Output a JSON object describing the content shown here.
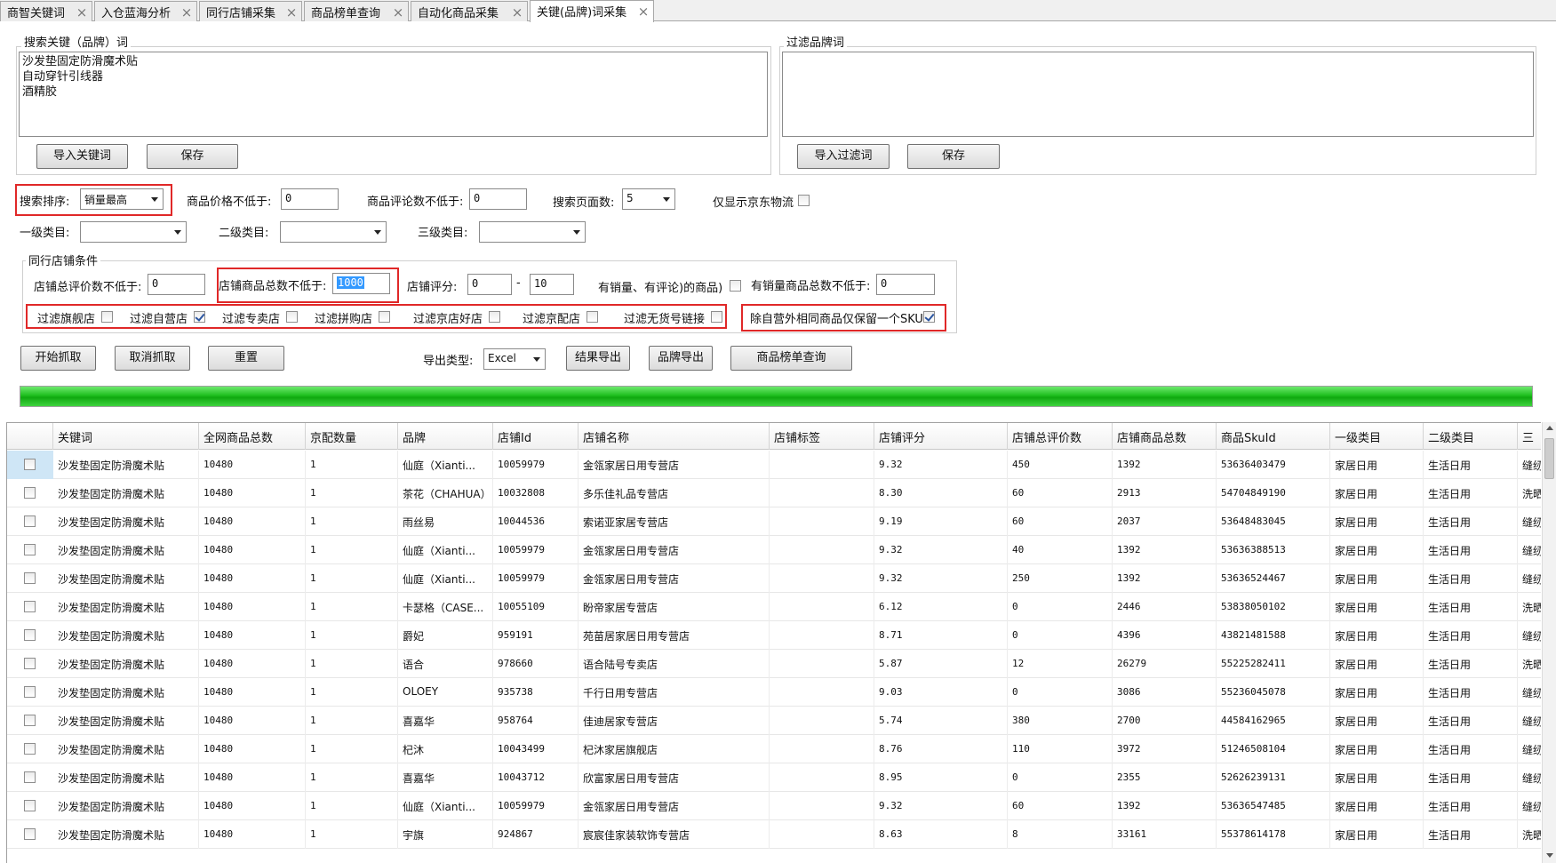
{
  "tabs": [
    {
      "label": "商智关键词"
    },
    {
      "label": "入仓蓝海分析"
    },
    {
      "label": "同行店铺采集"
    },
    {
      "label": "商品榜单查询"
    },
    {
      "label": "自动化商品采集"
    },
    {
      "label": "关键(品牌)词采集",
      "active": true
    }
  ],
  "search_keywords": {
    "title": "搜索关键（品牌）词",
    "lines": [
      "沙发垫固定防滑魔术贴",
      "自动穿针引线器",
      "酒精胶"
    ],
    "import_label": "导入关键词",
    "save_label": "保存"
  },
  "filter_brands": {
    "title": "过滤品牌词",
    "import_label": "导入过滤词",
    "save_label": "保存"
  },
  "options": {
    "sort_label": "搜索排序:",
    "sort_value": "销量最高",
    "min_price_label": "商品价格不低于:",
    "min_price": "0",
    "min_comments_label": "商品评论数不低于:",
    "min_comments": "0",
    "pages_label": "搜索页面数:",
    "pages": "5",
    "jd_logistics_label": "仅显示京东物流",
    "cat1_label": "一级类目:",
    "cat2_label": "二级类目:",
    "cat3_label": "三级类目:"
  },
  "shop_conditions": {
    "title": "同行店铺条件",
    "total_reviews_label": "店铺总评价数不低于:",
    "total_reviews": "0",
    "total_goods_label": "店铺商品总数不低于:",
    "total_goods": "1000",
    "rating_label": "店铺评分:",
    "rating_min": "0",
    "rating_sep": "-",
    "rating_max": "10",
    "has_sales_label": "有销量、有评论)的商品)",
    "sales_goods_label": "有销量商品总数不低于:",
    "sales_goods": "0",
    "filters": [
      {
        "label": "过滤旗舰店",
        "checked": false
      },
      {
        "label": "过滤自营店",
        "checked": true
      },
      {
        "label": "过滤专卖店",
        "checked": false
      },
      {
        "label": "过滤拼购店",
        "checked": false
      },
      {
        "label": "过滤京店好店",
        "checked": false
      },
      {
        "label": "过滤京配店",
        "checked": false
      },
      {
        "label": "过滤无货号链接",
        "checked": false
      }
    ],
    "keep_one_sku_label": "除自营外相同商品仅保留一个SKU",
    "keep_one_sku_checked": true
  },
  "actions": {
    "start": "开始抓取",
    "cancel": "取消抓取",
    "reset": "重置",
    "export_type_label": "导出类型:",
    "export_type": "Excel",
    "export_results": "结果导出",
    "export_brands": "品牌导出",
    "ranking_query": "商品榜单查询"
  },
  "progress": {
    "value": 1.0
  },
  "colors": {
    "progress": "#1fbf1f",
    "highlight": "#e02828",
    "selection": "#3399ff"
  },
  "table": {
    "columns": [
      "关键词",
      "全网商品总数",
      "京配数量",
      "品牌",
      "店铺Id",
      "店铺名称",
      "店铺标签",
      "店铺评分",
      "店铺总评价数",
      "店铺商品总数",
      "商品SkuId",
      "一级类目",
      "二级类目",
      "三"
    ],
    "rows": [
      [
        "沙发垫固定防滑魔术贴",
        "10480",
        "1",
        "仙庭（Xianti...",
        "10059979",
        "金瓴家居日用专营店",
        "",
        "9.32",
        "450",
        "1392",
        "53636403479",
        "家居日用",
        "生活日用",
        "缝纫"
      ],
      [
        "沙发垫固定防滑魔术贴",
        "10480",
        "1",
        "茶花（CHAHUA）",
        "10032808",
        "多乐佳礼品专营店",
        "",
        "8.30",
        "60",
        "2913",
        "54704849190",
        "家居日用",
        "生活日用",
        "洗晒"
      ],
      [
        "沙发垫固定防滑魔术贴",
        "10480",
        "1",
        "雨丝易",
        "10044536",
        "索诺亚家居专营店",
        "",
        "9.19",
        "60",
        "2037",
        "53648483045",
        "家居日用",
        "生活日用",
        "缝纫"
      ],
      [
        "沙发垫固定防滑魔术贴",
        "10480",
        "1",
        "仙庭（Xianti...",
        "10059979",
        "金瓴家居日用专营店",
        "",
        "9.32",
        "40",
        "1392",
        "53636388513",
        "家居日用",
        "生活日用",
        "缝纫"
      ],
      [
        "沙发垫固定防滑魔术贴",
        "10480",
        "1",
        "仙庭（Xianti...",
        "10059979",
        "金瓴家居日用专营店",
        "",
        "9.32",
        "250",
        "1392",
        "53636524467",
        "家居日用",
        "生活日用",
        "缝纫"
      ],
      [
        "沙发垫固定防滑魔术贴",
        "10480",
        "1",
        "卡瑟格（CASE...",
        "10055109",
        "盼帝家居专营店",
        "",
        "6.12",
        "0",
        "2446",
        "53838050102",
        "家居日用",
        "生活日用",
        "洗晒"
      ],
      [
        "沙发垫固定防滑魔术贴",
        "10480",
        "1",
        "爵妃",
        "959191",
        "苑苗居家居日用专营店",
        "",
        "8.71",
        "0",
        "4396",
        "43821481588",
        "家居日用",
        "生活日用",
        "缝纫"
      ],
      [
        "沙发垫固定防滑魔术贴",
        "10480",
        "1",
        "语合",
        "978660",
        "语合陆号专卖店",
        "",
        "5.87",
        "12",
        "26279",
        "55225282411",
        "家居日用",
        "生活日用",
        "洗晒"
      ],
      [
        "沙发垫固定防滑魔术贴",
        "10480",
        "1",
        "OLOEY",
        "935738",
        "千行日用专营店",
        "",
        "9.03",
        "0",
        "3086",
        "55236045078",
        "家居日用",
        "生活日用",
        "缝纫"
      ],
      [
        "沙发垫固定防滑魔术贴",
        "10480",
        "1",
        "喜嘉华",
        "958764",
        "佳迪居家专营店",
        "",
        "5.74",
        "380",
        "2700",
        "44584162965",
        "家居日用",
        "生活日用",
        "缝纫"
      ],
      [
        "沙发垫固定防滑魔术贴",
        "10480",
        "1",
        "杞沐",
        "10043499",
        "杞沐家居旗舰店",
        "",
        "8.76",
        "110",
        "3972",
        "51246508104",
        "家居日用",
        "生活日用",
        "缝纫"
      ],
      [
        "沙发垫固定防滑魔术贴",
        "10480",
        "1",
        "喜嘉华",
        "10043712",
        "欣富家居日用专营店",
        "",
        "8.95",
        "0",
        "2355",
        "52626239131",
        "家居日用",
        "生活日用",
        "缝纫"
      ],
      [
        "沙发垫固定防滑魔术贴",
        "10480",
        "1",
        "仙庭（Xianti...",
        "10059979",
        "金瓴家居日用专营店",
        "",
        "9.32",
        "60",
        "1392",
        "53636547485",
        "家居日用",
        "生活日用",
        "缝纫"
      ],
      [
        "沙发垫固定防滑魔术贴",
        "10480",
        "1",
        "宇旗",
        "924867",
        "宸宸佳家装软饰专营店",
        "",
        "8.63",
        "8",
        "33161",
        "55378614178",
        "家居日用",
        "生活日用",
        "洗晒"
      ]
    ]
  }
}
